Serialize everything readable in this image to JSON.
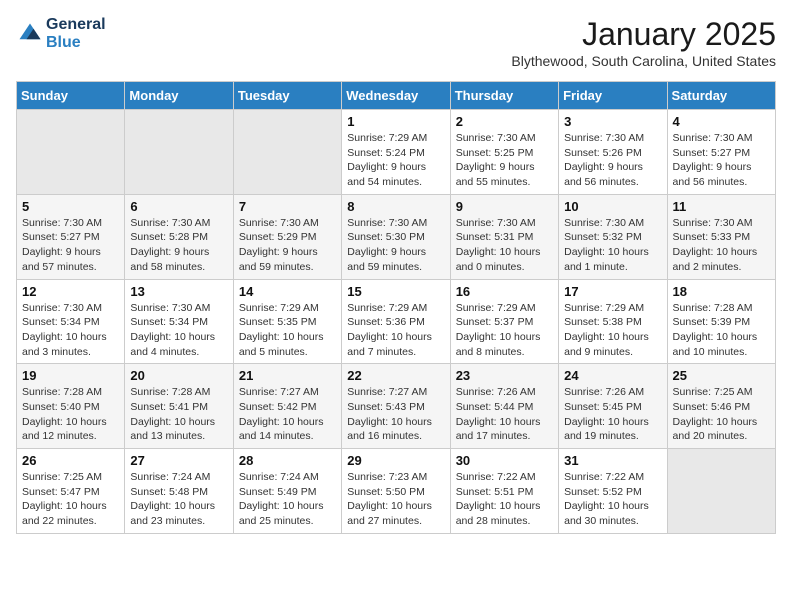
{
  "header": {
    "logo_line1": "General",
    "logo_line2": "Blue",
    "month": "January 2025",
    "location": "Blythewood, South Carolina, United States"
  },
  "weekdays": [
    "Sunday",
    "Monday",
    "Tuesday",
    "Wednesday",
    "Thursday",
    "Friday",
    "Saturday"
  ],
  "weeks": [
    [
      {
        "day": "",
        "info": ""
      },
      {
        "day": "",
        "info": ""
      },
      {
        "day": "",
        "info": ""
      },
      {
        "day": "1",
        "info": "Sunrise: 7:29 AM\nSunset: 5:24 PM\nDaylight: 9 hours\nand 54 minutes."
      },
      {
        "day": "2",
        "info": "Sunrise: 7:30 AM\nSunset: 5:25 PM\nDaylight: 9 hours\nand 55 minutes."
      },
      {
        "day": "3",
        "info": "Sunrise: 7:30 AM\nSunset: 5:26 PM\nDaylight: 9 hours\nand 56 minutes."
      },
      {
        "day": "4",
        "info": "Sunrise: 7:30 AM\nSunset: 5:27 PM\nDaylight: 9 hours\nand 56 minutes."
      }
    ],
    [
      {
        "day": "5",
        "info": "Sunrise: 7:30 AM\nSunset: 5:27 PM\nDaylight: 9 hours\nand 57 minutes."
      },
      {
        "day": "6",
        "info": "Sunrise: 7:30 AM\nSunset: 5:28 PM\nDaylight: 9 hours\nand 58 minutes."
      },
      {
        "day": "7",
        "info": "Sunrise: 7:30 AM\nSunset: 5:29 PM\nDaylight: 9 hours\nand 59 minutes."
      },
      {
        "day": "8",
        "info": "Sunrise: 7:30 AM\nSunset: 5:30 PM\nDaylight: 9 hours\nand 59 minutes."
      },
      {
        "day": "9",
        "info": "Sunrise: 7:30 AM\nSunset: 5:31 PM\nDaylight: 10 hours\nand 0 minutes."
      },
      {
        "day": "10",
        "info": "Sunrise: 7:30 AM\nSunset: 5:32 PM\nDaylight: 10 hours\nand 1 minute."
      },
      {
        "day": "11",
        "info": "Sunrise: 7:30 AM\nSunset: 5:33 PM\nDaylight: 10 hours\nand 2 minutes."
      }
    ],
    [
      {
        "day": "12",
        "info": "Sunrise: 7:30 AM\nSunset: 5:34 PM\nDaylight: 10 hours\nand 3 minutes."
      },
      {
        "day": "13",
        "info": "Sunrise: 7:30 AM\nSunset: 5:34 PM\nDaylight: 10 hours\nand 4 minutes."
      },
      {
        "day": "14",
        "info": "Sunrise: 7:29 AM\nSunset: 5:35 PM\nDaylight: 10 hours\nand 5 minutes."
      },
      {
        "day": "15",
        "info": "Sunrise: 7:29 AM\nSunset: 5:36 PM\nDaylight: 10 hours\nand 7 minutes."
      },
      {
        "day": "16",
        "info": "Sunrise: 7:29 AM\nSunset: 5:37 PM\nDaylight: 10 hours\nand 8 minutes."
      },
      {
        "day": "17",
        "info": "Sunrise: 7:29 AM\nSunset: 5:38 PM\nDaylight: 10 hours\nand 9 minutes."
      },
      {
        "day": "18",
        "info": "Sunrise: 7:28 AM\nSunset: 5:39 PM\nDaylight: 10 hours\nand 10 minutes."
      }
    ],
    [
      {
        "day": "19",
        "info": "Sunrise: 7:28 AM\nSunset: 5:40 PM\nDaylight: 10 hours\nand 12 minutes."
      },
      {
        "day": "20",
        "info": "Sunrise: 7:28 AM\nSunset: 5:41 PM\nDaylight: 10 hours\nand 13 minutes."
      },
      {
        "day": "21",
        "info": "Sunrise: 7:27 AM\nSunset: 5:42 PM\nDaylight: 10 hours\nand 14 minutes."
      },
      {
        "day": "22",
        "info": "Sunrise: 7:27 AM\nSunset: 5:43 PM\nDaylight: 10 hours\nand 16 minutes."
      },
      {
        "day": "23",
        "info": "Sunrise: 7:26 AM\nSunset: 5:44 PM\nDaylight: 10 hours\nand 17 minutes."
      },
      {
        "day": "24",
        "info": "Sunrise: 7:26 AM\nSunset: 5:45 PM\nDaylight: 10 hours\nand 19 minutes."
      },
      {
        "day": "25",
        "info": "Sunrise: 7:25 AM\nSunset: 5:46 PM\nDaylight: 10 hours\nand 20 minutes."
      }
    ],
    [
      {
        "day": "26",
        "info": "Sunrise: 7:25 AM\nSunset: 5:47 PM\nDaylight: 10 hours\nand 22 minutes."
      },
      {
        "day": "27",
        "info": "Sunrise: 7:24 AM\nSunset: 5:48 PM\nDaylight: 10 hours\nand 23 minutes."
      },
      {
        "day": "28",
        "info": "Sunrise: 7:24 AM\nSunset: 5:49 PM\nDaylight: 10 hours\nand 25 minutes."
      },
      {
        "day": "29",
        "info": "Sunrise: 7:23 AM\nSunset: 5:50 PM\nDaylight: 10 hours\nand 27 minutes."
      },
      {
        "day": "30",
        "info": "Sunrise: 7:22 AM\nSunset: 5:51 PM\nDaylight: 10 hours\nand 28 minutes."
      },
      {
        "day": "31",
        "info": "Sunrise: 7:22 AM\nSunset: 5:52 PM\nDaylight: 10 hours\nand 30 minutes."
      },
      {
        "day": "",
        "info": ""
      }
    ]
  ]
}
